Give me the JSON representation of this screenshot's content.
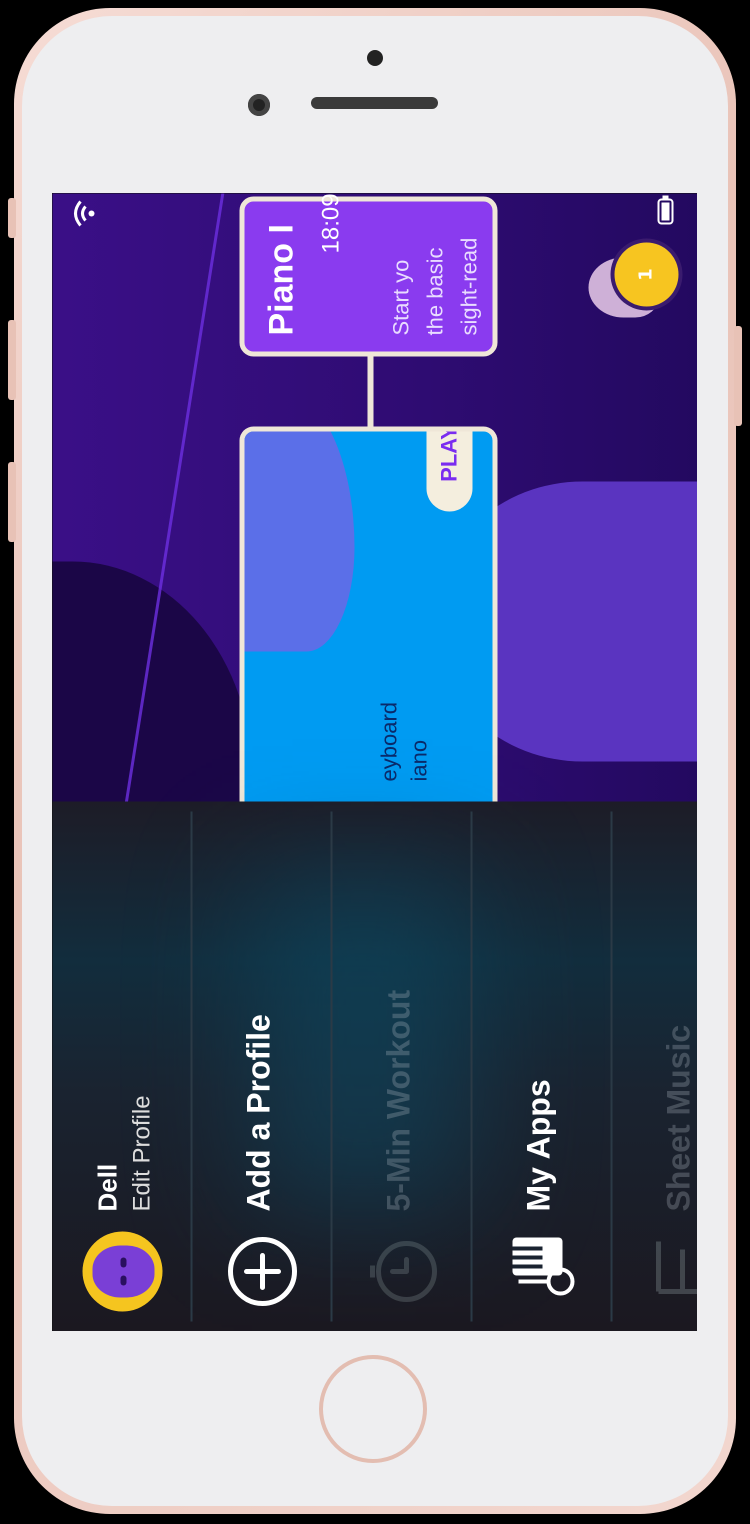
{
  "status_bar": {
    "time": "18:09",
    "wifi_icon": "wifi-icon",
    "battery_icon": "battery-icon"
  },
  "menu": {
    "profile": {
      "name": "Dell",
      "action": "Edit Profile"
    },
    "items": [
      {
        "label": "Add a Profile",
        "icon": "plus-circle-icon",
        "enabled": true
      },
      {
        "label": "5-Min Workout",
        "icon": "stopwatch-icon",
        "enabled": false
      },
      {
        "label": "My Apps",
        "icon": "instruments-icon",
        "enabled": true
      },
      {
        "label": "Sheet Music",
        "icon": "sheet-music-icon",
        "enabled": false
      }
    ]
  },
  "lesson": {
    "top_card": {
      "title": "Piano I",
      "desc": "Start yo\nthe basic\nsight-read"
    },
    "current_card": {
      "text": "eyboard\niano",
      "play_label": "PLAY"
    },
    "streak": {
      "count": "1",
      "icon": "flame-icon"
    }
  },
  "colors": {
    "menu_bg": "#1b1820",
    "lesson_bg": "#3a0f87",
    "card_purple": "#8a3bef",
    "card_blue": "#009bf2",
    "accent_yellow": "#f5c51f"
  }
}
